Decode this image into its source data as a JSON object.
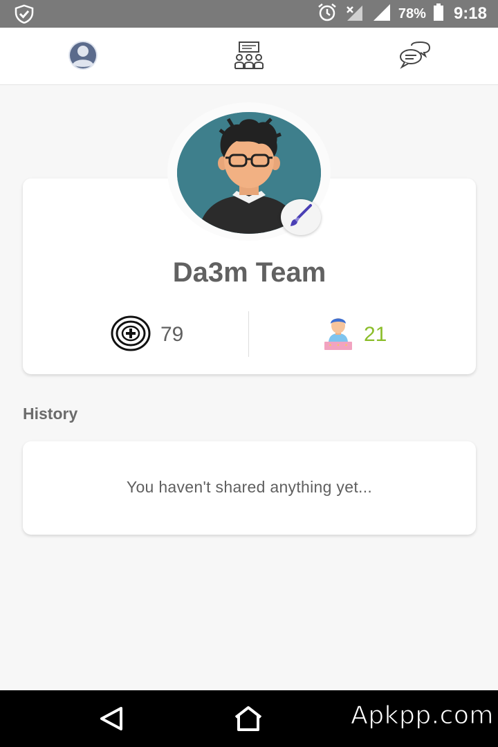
{
  "status_bar": {
    "battery_percent": "78%",
    "time": "9:18",
    "icons": [
      "shield-check-icon",
      "alarm-icon",
      "signal-x-icon",
      "signal-icon",
      "battery-icon"
    ]
  },
  "top_nav": {
    "tabs": [
      {
        "name": "profile",
        "icon": "user-avatar-icon",
        "active": true
      },
      {
        "name": "community",
        "icon": "group-presentation-icon",
        "active": false
      },
      {
        "name": "chat",
        "icon": "chat-bubbles-icon",
        "active": false
      }
    ]
  },
  "profile": {
    "username": "Da3m Team",
    "avatar_icon": "user-portrait-glasses",
    "edit_icon": "paintbrush-icon",
    "stats": {
      "points": "79",
      "points_icon": "medal-plus-icon",
      "rank": "21",
      "rank_icon": "user-stars-icon"
    }
  },
  "history": {
    "label": "History",
    "empty_message": "You haven't shared anything yet..."
  },
  "nav_bar": {
    "buttons": [
      "back-icon",
      "home-icon"
    ],
    "watermark": "Apkpp.com"
  },
  "colors": {
    "status_bar": "#7a7a7a",
    "background": "#f7f7f7",
    "rank_green": "#8bbd2a",
    "avatar_bg": "#3e7f8c",
    "nav_icon": "#5b6b8c"
  }
}
